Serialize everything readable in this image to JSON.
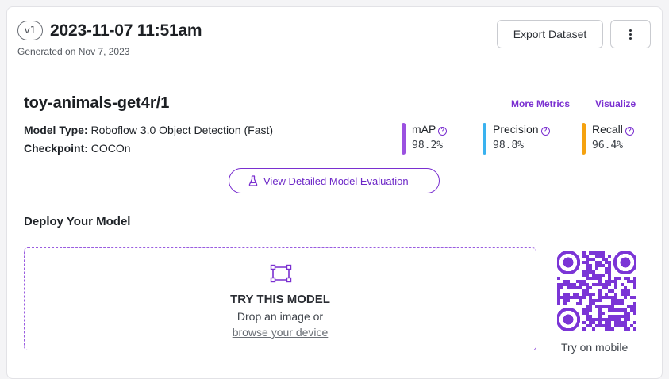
{
  "header": {
    "version_badge": "v1",
    "title": "2023-11-07 11:51am",
    "generated": "Generated on Nov 7, 2023",
    "export_label": "Export Dataset",
    "more_icon": "vertical-ellipsis-icon"
  },
  "model": {
    "name": "toy-animals-get4r/1",
    "more_metrics": "More Metrics",
    "visualize": "Visualize",
    "type_label": "Model Type:",
    "type_value": "Roboflow 3.0 Object Detection (Fast)",
    "checkpoint_label": "Checkpoint:",
    "checkpoint_value": "COCOn",
    "metrics": [
      {
        "label": "mAP",
        "value": "98.2%",
        "color": "#9b51e0"
      },
      {
        "label": "Precision",
        "value": "98.8%",
        "color": "#3ab2ef"
      },
      {
        "label": "Recall",
        "value": "96.4%",
        "color": "#f5a20f"
      }
    ],
    "eval_button": "View Detailed Model Evaluation"
  },
  "deploy": {
    "title": "Deploy Your Model",
    "try_title": "TRY THIS MODEL",
    "drop_text": "Drop an image or",
    "browse_text": "browse your device",
    "qr_caption": "Try on mobile"
  },
  "colors": {
    "accent": "#7a2fd0",
    "qr": "#7b35d6"
  }
}
